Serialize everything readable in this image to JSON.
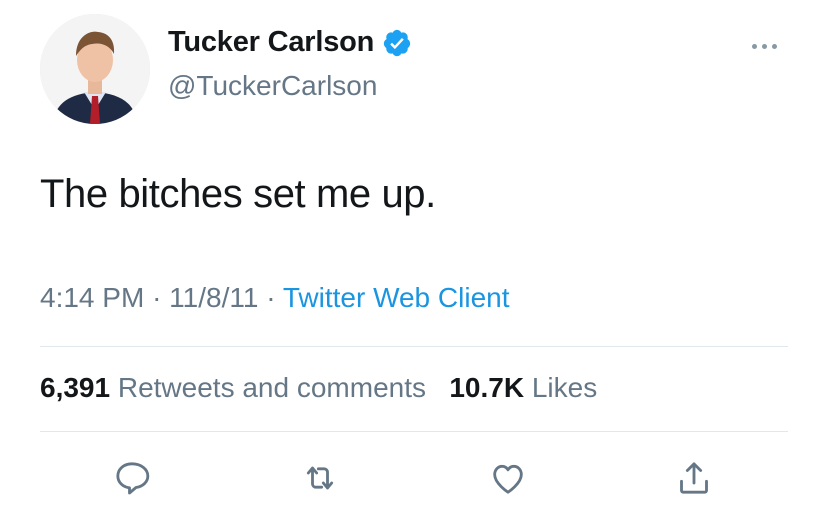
{
  "author": {
    "display_name": "Tucker Carlson",
    "handle": "@TuckerCarlson",
    "verified": true
  },
  "tweet": {
    "text": "The bitches set me up.",
    "time": "4:14 PM",
    "separator": "·",
    "date": "11/8/11",
    "client": "Twitter Web Client"
  },
  "stats": {
    "retweets_count": "6,391",
    "retweets_label": "Retweets and comments",
    "likes_count": "10.7K",
    "likes_label": "Likes"
  },
  "icons": {
    "verified": "verified-badge-icon",
    "more": "more-icon",
    "reply": "reply-icon",
    "retweet": "retweet-icon",
    "like": "like-icon",
    "share": "share-icon"
  },
  "colors": {
    "text": "#14171a",
    "secondary": "#657786",
    "link": "#1b95e0",
    "verified": "#1da1f2",
    "divider": "#e1e8ed",
    "icon": "#657786"
  }
}
